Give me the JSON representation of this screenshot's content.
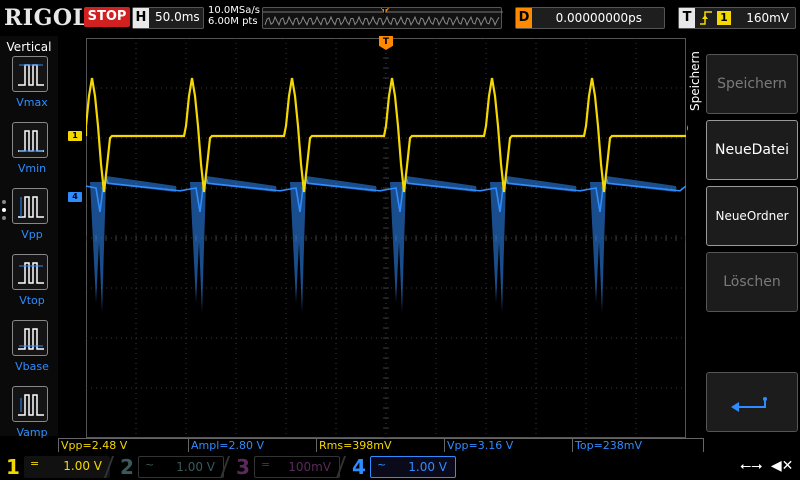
{
  "header": {
    "logo": "RIGOL",
    "run_state": "STOP",
    "timebase_label": "H",
    "timebase": "50.0ms",
    "sample_rate": "10.0MSa/s",
    "memory_depth": "6.00M pts",
    "trigger_marker": "T",
    "delay_label": "D",
    "delay": "0.00000000ps",
    "trigger_label": "T",
    "trigger_edge": "rising-edge-icon",
    "trigger_source": "1",
    "trigger_level": "160mV"
  },
  "left_panel": {
    "title": "Vertical",
    "items": [
      {
        "label": "Vmax",
        "icon": "vmax-icon"
      },
      {
        "label": "Vmin",
        "icon": "vmin-icon"
      },
      {
        "label": "Vpp",
        "icon": "vpp-icon"
      },
      {
        "label": "Vtop",
        "icon": "vtop-icon"
      },
      {
        "label": "Vbase",
        "icon": "vbase-icon"
      },
      {
        "label": "Vamp",
        "icon": "vamp-icon"
      }
    ]
  },
  "right_menu": {
    "title": "Speichern",
    "buttons": [
      {
        "label": "Speichern",
        "state": "disabled"
      },
      {
        "label": "NeueDatei",
        "state": "active"
      },
      {
        "label": "NeueOrdner",
        "state": "active"
      },
      {
        "label": "Löschen",
        "state": "disabled"
      }
    ],
    "return_icon": "return-icon"
  },
  "waveform": {
    "ch1_marker": "1",
    "ch4_marker": "4",
    "trigger_marker": "T",
    "ch1_color": "#f5d800",
    "ch4_color": "#2f8cff",
    "grid_color": "#3a3a3a"
  },
  "measurements": [
    {
      "text": "Vpp=2.48 V",
      "color": "yellow"
    },
    {
      "text": "Ampl=2.80 V",
      "color": "blue"
    },
    {
      "text": "Rms=398mV",
      "color": "yellow"
    },
    {
      "text": "Vpp=3.16 V",
      "color": "blue"
    },
    {
      "text": "Top=238mV",
      "color": "blue"
    }
  ],
  "channels": [
    {
      "num": "1",
      "coupling": "=",
      "scale": "1.00 V"
    },
    {
      "num": "2",
      "coupling": "~",
      "scale": "1.00 V"
    },
    {
      "num": "3",
      "coupling": "=",
      "scale": "100mV"
    },
    {
      "num": "4",
      "coupling": "~",
      "scale": "1.00 V"
    }
  ],
  "status": {
    "usb_icon": "usb-icon",
    "mute_icon": "speaker-mute-icon"
  }
}
